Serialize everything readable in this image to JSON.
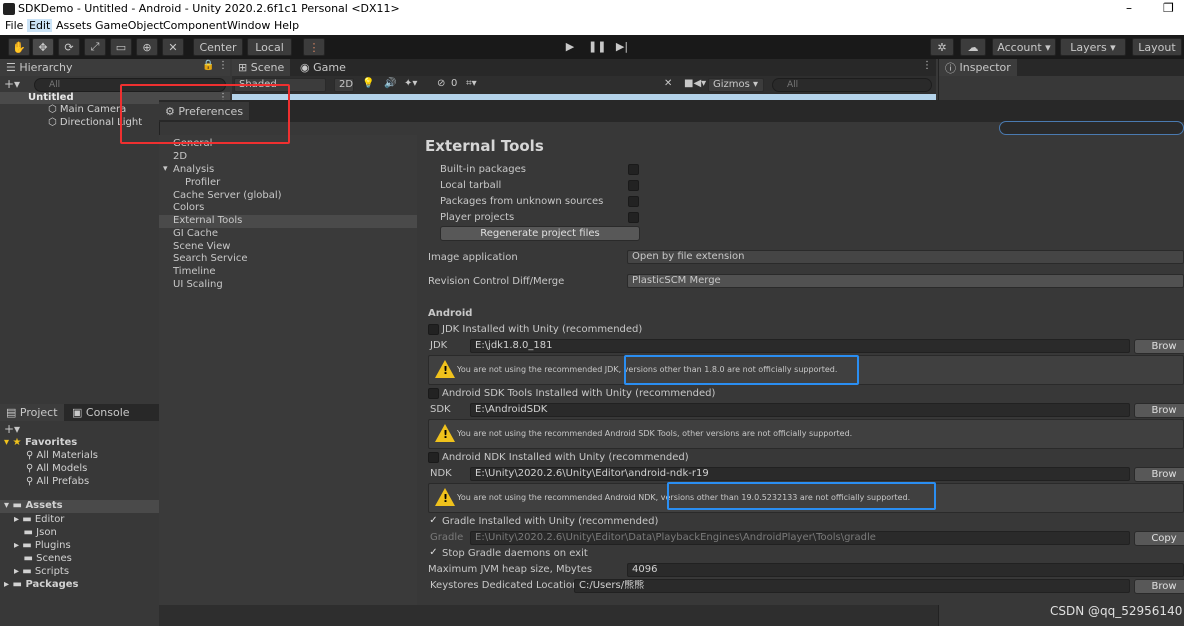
{
  "window": {
    "title": "SDKDemo - Untitled - Android - Unity 2020.2.6f1c1 Personal <DX11>",
    "minimize": "–",
    "maximize": "❐"
  },
  "menu": [
    "File",
    "Edit",
    "Assets",
    "GameObject",
    "Component",
    "Window",
    "Help"
  ],
  "toolbar": {
    "center": "Center",
    "local": "Local",
    "account": "Account",
    "layers": "Layers",
    "layout": "Layout"
  },
  "hierarchy": {
    "tab": "Hierarchy",
    "search_placeholder": "All",
    "scene": "Untitled",
    "items": [
      "Main Camera",
      "Directional Light"
    ]
  },
  "scene_tabs": {
    "scene": "Scene",
    "game": "Game",
    "shading": "Shaded",
    "mode2d": "2D",
    "hidden_count": "0",
    "gizmos": "Gizmos",
    "search_placeholder": "All"
  },
  "inspector": {
    "tab": "Inspector"
  },
  "project": {
    "tab_project": "Project",
    "tab_console": "Console",
    "favorites": "Favorites",
    "fav_items": [
      "All Materials",
      "All Models",
      "All Prefabs"
    ],
    "assets": "Assets",
    "asset_items": [
      "Editor",
      "Json",
      "Plugins",
      "Scenes",
      "Scripts"
    ],
    "packages": "Packages"
  },
  "preferences": {
    "tab": "Preferences",
    "nav": [
      "General",
      "2D",
      "Analysis",
      "Profiler",
      "Cache Server (global)",
      "Colors",
      "External Tools",
      "GI Cache",
      "Scene View",
      "Search Service",
      "Timeline",
      "UI Scaling"
    ],
    "selected_nav": "External Tools",
    "heading": "External Tools",
    "gen_items": [
      "Built-in packages",
      "Local tarball",
      "Packages from unknown sources",
      "Player projects"
    ],
    "regen_button": "Regenerate project files",
    "image_app_label": "Image application",
    "image_app_value": "Open by file extension",
    "revision_label": "Revision Control Diff/Merge",
    "revision_value": "PlasticSCM Merge",
    "android_heading": "Android",
    "jdk_check": "JDK Installed with Unity (recommended)",
    "jdk_label": "JDK",
    "jdk_value": "E:\\jdk1.8.0_181",
    "jdk_warning": "You are not using the recommended JDK, versions other than 1.8.0 are not officially supported.",
    "sdk_check": "Android SDK Tools Installed with Unity (recommended)",
    "sdk_label": "SDK",
    "sdk_value": "E:\\AndroidSDK",
    "sdk_warning": "You are not using the recommended Android SDK Tools, other versions are not officially supported.",
    "ndk_check": "Android NDK Installed with Unity (recommended)",
    "ndk_label": "NDK",
    "ndk_value": "E:\\Unity\\2020.2.6\\Unity\\Editor\\android-ndk-r19",
    "ndk_warning": "You are not using the recommended Android NDK, versions other than 19.0.5232133 are not officially supported.",
    "gradle_check": "Gradle Installed with Unity (recommended)",
    "gradle_label": "Gradle",
    "gradle_value": "E:\\Unity\\2020.2.6\\Unity\\Editor\\Data\\PlaybackEngines\\AndroidPlayer\\Tools\\gradle",
    "gradle_stop": "Stop Gradle daemons on exit",
    "heap_label": "Maximum JVM heap size, Mbytes",
    "heap_value": "4096",
    "keystore_label": "Keystores Dedicated Location",
    "keystore_value": "C:/Users/熊熊",
    "browse": "Brow",
    "copy": "Copy",
    "check_mark": "✓"
  },
  "watermark": "CSDN @qq_52956140"
}
